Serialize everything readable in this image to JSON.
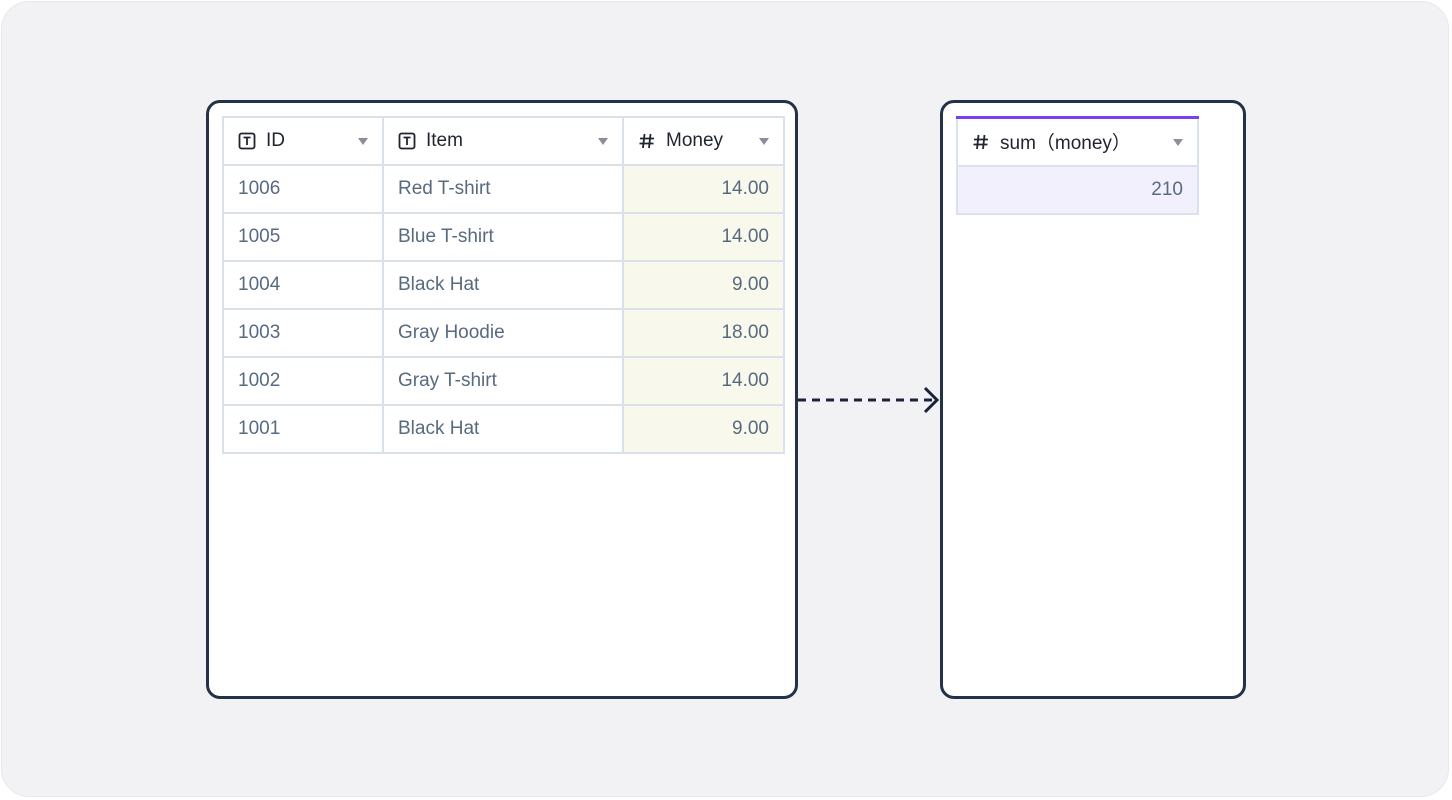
{
  "source_table": {
    "columns": [
      {
        "label": "ID",
        "type_icon": "text-field-icon"
      },
      {
        "label": "Item",
        "type_icon": "text-field-icon"
      },
      {
        "label": "Money",
        "type_icon": "number-field-icon"
      }
    ],
    "rows": [
      {
        "id": "1006",
        "item": "Red T-shirt",
        "money": "14.00"
      },
      {
        "id": "1005",
        "item": "Blue T-shirt",
        "money": "14.00"
      },
      {
        "id": "1004",
        "item": "Black Hat",
        "money": "9.00"
      },
      {
        "id": "1003",
        "item": "Gray Hoodie",
        "money": "18.00"
      },
      {
        "id": "1002",
        "item": "Gray T-shirt",
        "money": "14.00"
      },
      {
        "id": "1001",
        "item": "Black Hat",
        "money": "9.00"
      }
    ]
  },
  "result_table": {
    "column": {
      "label": "sum（money）",
      "type_icon": "number-field-icon"
    },
    "value": "210"
  },
  "colors": {
    "frame_border": "#243247",
    "number_cell_bg": "#f9f8ec",
    "result_accent": "#7b3ef0",
    "result_cell_bg": "#f3f0fd"
  }
}
